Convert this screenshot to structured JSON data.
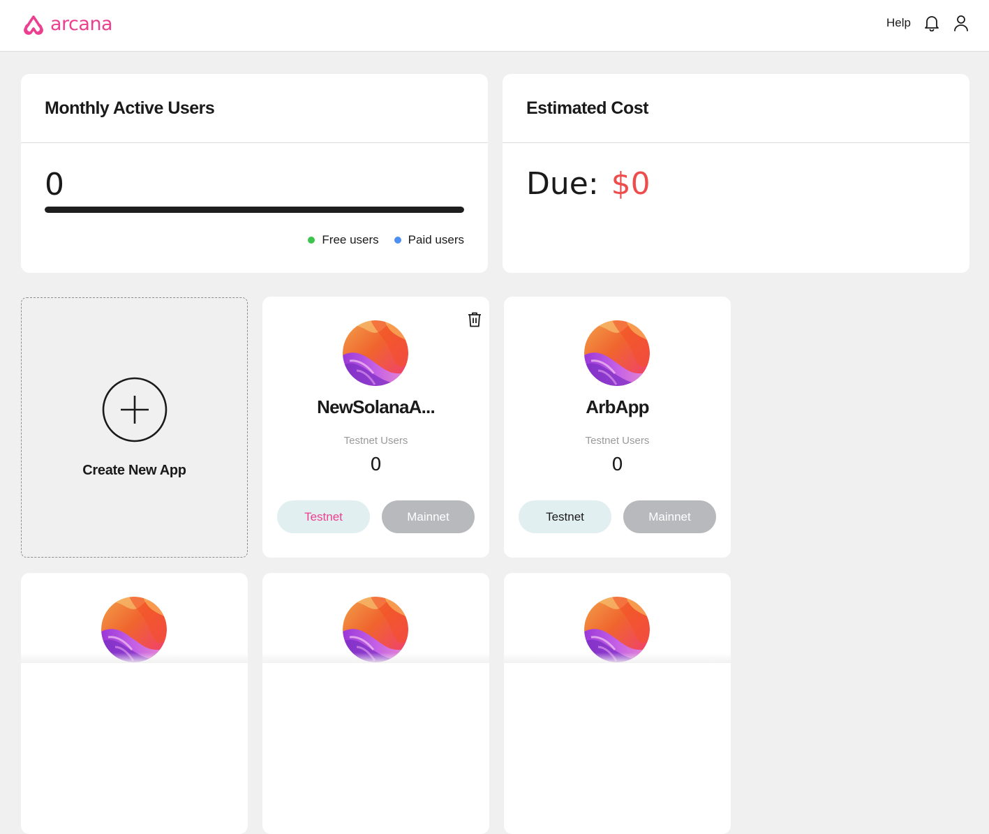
{
  "header": {
    "logo_text": "arcana",
    "help_label": "Help",
    "bell_icon": "bell-icon",
    "user_icon": "user-icon",
    "brand_color": "#ec3f8f"
  },
  "mau_card": {
    "title": "Monthly Active Users",
    "value": "0",
    "progress_fraction": 1.0,
    "legend": [
      {
        "label": "Free users",
        "color": "#3cc44e"
      },
      {
        "label": "Paid users",
        "color": "#4e8ff2"
      }
    ]
  },
  "cost_card": {
    "title": "Estimated Cost",
    "due_label": "Due:",
    "due_amount": "$0",
    "due_color": "#ee4d4d"
  },
  "create_app": {
    "label": "Create New App",
    "icon": "plus-circle-icon"
  },
  "apps": [
    {
      "name": "NewSolanaA...",
      "users_label": "Testnet Users",
      "users_value": "0",
      "testnet_label": "Testnet",
      "mainnet_label": "Mainnet",
      "testnet_active": true,
      "show_delete": true
    },
    {
      "name": "ArbApp",
      "users_label": "Testnet Users",
      "users_value": "0",
      "testnet_label": "Testnet",
      "mainnet_label": "Mainnet",
      "testnet_active": false,
      "show_delete": false
    }
  ]
}
